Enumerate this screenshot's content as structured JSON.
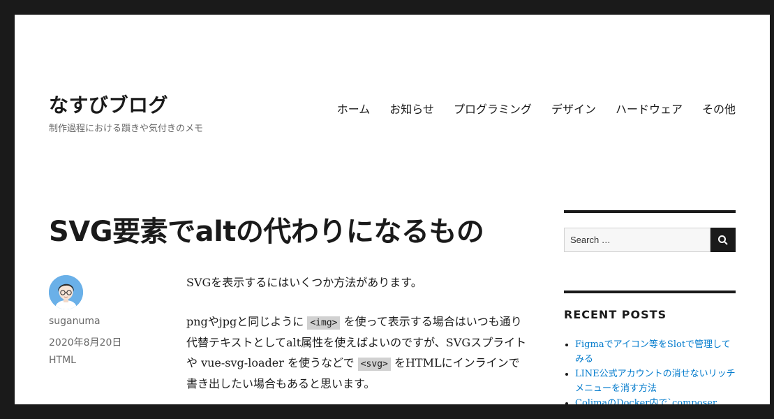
{
  "site": {
    "title": "なすびブログ",
    "description": "制作過程における躓きや気付きのメモ"
  },
  "nav": {
    "items": [
      {
        "label": "ホーム"
      },
      {
        "label": "お知らせ"
      },
      {
        "label": "プログラミング"
      },
      {
        "label": "デザイン"
      },
      {
        "label": "ハードウェア"
      },
      {
        "label": "その他"
      }
    ]
  },
  "post": {
    "title": "SVG要素でaltの代わりになるもの",
    "author": "suganuma",
    "date": "2020年8月20日",
    "category": "HTML",
    "p1": "SVGを表示するにはいくつか方法があります。",
    "p2_a": "pngやjpgと同じように",
    "p2_code1": "<img>",
    "p2_b": "を使って表示する場合はいつも通り代替テキストとしてalt属性を使えばよいのですが、SVGスプライトや vue-svg-loader を使うなどで",
    "p2_code2": "<svg>",
    "p2_c": "をHTMLにインラインで書き出したい場合もあると思います。"
  },
  "search": {
    "placeholder": "Search …",
    "button_icon": "search-icon"
  },
  "recent": {
    "title": "RECENT POSTS",
    "items": [
      {
        "label": "Figmaでアイコン等をSlotで管理してみる"
      },
      {
        "label": "LINE公式アカウントの消せないリッチメニューを消す方法"
      },
      {
        "label": "ColimaのDocker内で`composer"
      }
    ]
  },
  "colors": {
    "frame": "#1a1a1a",
    "link": "#007acc",
    "avatar_bg": "#6ab0e8"
  }
}
